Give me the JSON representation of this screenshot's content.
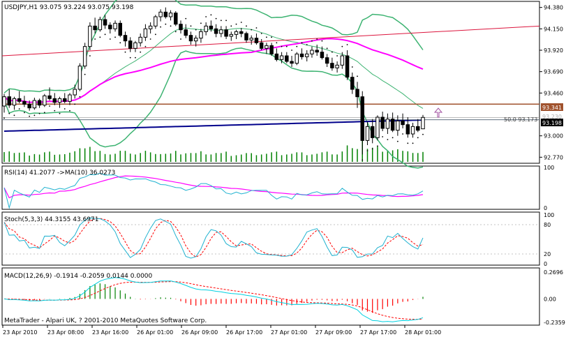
{
  "colors": {
    "background": "#ffffff",
    "frame": "#000000",
    "grid": "#c8c8c8",
    "candle": "#000000",
    "volume": "#008000",
    "bands": "#3cb371",
    "ma_blue": "#00008b",
    "ma_magenta": "#ff00ff",
    "trend_red": "#dc143c",
    "hline_brown": "#a0522d",
    "hline_gray": "#607080",
    "sar": "#000000",
    "rsi": "#20b2d0",
    "rsi_ma": "#ff00ff",
    "stoch_main": "#20b2d0",
    "stoch_signal": "#ff0000",
    "macd_main": "#00d0e0",
    "macd_signal": "#ff0000",
    "macd_osma_pos": "#008000",
    "macd_osma_neg": "#ff0000",
    "bid_label_bg": "#000000",
    "brown_label_bg": "#a0522d",
    "arrow": "#a050a0"
  },
  "main": {
    "label": "USDJPY,H1  93.075 93.224 93.075 93.198",
    "price_ticks": [
      "94.380",
      "94.150",
      "93.920",
      "93.690",
      "93.460",
      "93.000",
      "92.770"
    ],
    "price_range": [
      92.72,
      94.43
    ],
    "last_price": "93.198",
    "last_price_value": 93.198,
    "level_brown": "93.341",
    "level_brown_value": 93.341,
    "hidden_tick": "93.230",
    "fib_label": "50.0  93.173",
    "fib_level": 93.173
  },
  "rsi": {
    "label": "RSI(14) 41.2077  ->MA(10) 36.0273",
    "ticks": [
      "100",
      "0"
    ],
    "range": [
      0,
      100
    ]
  },
  "stoch": {
    "label": "Stoch(5,3,3) 44.3155 43.6971",
    "ticks": [
      "100",
      "80",
      "20",
      "0"
    ],
    "range": [
      0,
      100
    ],
    "levels": [
      80,
      20
    ]
  },
  "macd": {
    "label": "MACD(12,26,9) -0.1914 -0.2059 0.0144 0.0000",
    "ticks": [
      "0.2696",
      "0.00",
      "-0.2359"
    ],
    "range": [
      -0.2359,
      0.2696
    ]
  },
  "copyright": "MetaTrader - Alpari UK, ? 2001-2010 MetaQuotes Software Corp.",
  "time_labels": [
    "23 Apr 2010",
    "23 Apr 08:00",
    "23 Apr 16:00",
    "26 Apr 01:00",
    "26 Apr 09:00",
    "26 Apr 17:00",
    "27 Apr 01:00",
    "27 Apr 09:00",
    "27 Apr 17:00",
    "28 Apr 01:00"
  ],
  "chart_data": {
    "type": "candlestick",
    "symbol": "USDJPY",
    "timeframe": "H1",
    "candles_ohlc": [
      [
        93.32,
        93.45,
        93.25,
        93.42
      ],
      [
        93.42,
        93.5,
        93.3,
        93.33
      ],
      [
        93.33,
        93.42,
        93.28,
        93.4
      ],
      [
        93.4,
        93.48,
        93.35,
        93.37
      ],
      [
        93.37,
        93.43,
        93.31,
        93.34
      ],
      [
        93.34,
        93.38,
        93.27,
        93.3
      ],
      [
        93.3,
        93.41,
        93.28,
        93.38
      ],
      [
        93.38,
        93.4,
        93.3,
        93.33
      ],
      [
        93.33,
        93.45,
        93.31,
        93.43
      ],
      [
        93.43,
        93.52,
        93.38,
        93.4
      ],
      [
        93.4,
        93.46,
        93.33,
        93.36
      ],
      [
        93.36,
        93.42,
        93.3,
        93.4
      ],
      [
        93.4,
        93.46,
        93.35,
        93.37
      ],
      [
        93.37,
        93.46,
        93.33,
        93.44
      ],
      [
        93.44,
        93.55,
        93.4,
        93.5
      ],
      [
        93.5,
        93.78,
        93.48,
        93.75
      ],
      [
        93.75,
        94.0,
        93.72,
        93.96
      ],
      [
        93.96,
        94.22,
        93.92,
        94.18
      ],
      [
        94.18,
        94.27,
        94.1,
        94.14
      ],
      [
        94.14,
        94.28,
        94.12,
        94.25
      ],
      [
        94.25,
        94.3,
        94.15,
        94.19
      ],
      [
        94.19,
        94.22,
        94.1,
        94.15
      ],
      [
        94.15,
        94.24,
        94.12,
        94.21
      ],
      [
        94.21,
        94.24,
        94.06,
        94.08
      ],
      [
        94.08,
        94.12,
        93.96,
        94.02
      ],
      [
        94.02,
        94.06,
        93.9,
        93.94
      ],
      [
        93.94,
        94.02,
        93.9,
        94.0
      ],
      [
        94.0,
        94.1,
        93.96,
        94.06
      ],
      [
        94.06,
        94.2,
        94.02,
        94.15
      ],
      [
        94.15,
        94.22,
        94.1,
        94.18
      ],
      [
        94.18,
        94.3,
        94.15,
        94.28
      ],
      [
        94.28,
        94.36,
        94.23,
        94.33
      ],
      [
        94.33,
        94.38,
        94.26,
        94.28
      ],
      [
        94.28,
        94.35,
        94.24,
        94.32
      ],
      [
        94.32,
        94.34,
        94.18,
        94.2
      ],
      [
        94.2,
        94.24,
        94.1,
        94.14
      ],
      [
        94.14,
        94.2,
        94.05,
        94.08
      ],
      [
        94.08,
        94.12,
        93.98,
        94.02
      ],
      [
        94.02,
        94.08,
        93.96,
        94.05
      ],
      [
        94.05,
        94.15,
        94.0,
        94.12
      ],
      [
        94.12,
        94.22,
        94.08,
        94.18
      ],
      [
        94.18,
        94.24,
        94.12,
        94.15
      ],
      [
        94.15,
        94.2,
        94.06,
        94.1
      ],
      [
        94.1,
        94.18,
        94.06,
        94.14
      ],
      [
        94.14,
        94.18,
        94.04,
        94.07
      ],
      [
        94.07,
        94.12,
        94.02,
        94.09
      ],
      [
        94.09,
        94.14,
        94.04,
        94.12
      ],
      [
        94.12,
        94.16,
        94.06,
        94.1
      ],
      [
        94.1,
        94.12,
        94.0,
        94.03
      ],
      [
        94.03,
        94.08,
        93.98,
        94.05
      ],
      [
        94.05,
        94.1,
        93.98,
        94.0
      ],
      [
        94.0,
        94.04,
        93.92,
        93.94
      ],
      [
        93.94,
        94.0,
        93.88,
        93.97
      ],
      [
        93.97,
        94.0,
        93.86,
        93.88
      ],
      [
        93.88,
        93.94,
        93.8,
        93.82
      ],
      [
        93.82,
        93.9,
        93.78,
        93.86
      ],
      [
        93.86,
        93.9,
        93.78,
        93.8
      ],
      [
        93.8,
        93.86,
        93.74,
        93.78
      ],
      [
        93.78,
        93.9,
        93.76,
        93.88
      ],
      [
        93.88,
        93.94,
        93.82,
        93.85
      ],
      [
        93.85,
        93.92,
        93.8,
        93.88
      ],
      [
        93.88,
        93.96,
        93.84,
        93.92
      ],
      [
        93.92,
        93.98,
        93.86,
        93.9
      ],
      [
        93.9,
        93.96,
        93.82,
        93.84
      ],
      [
        93.84,
        93.88,
        93.74,
        93.78
      ],
      [
        93.78,
        93.84,
        93.7,
        93.73
      ],
      [
        93.73,
        93.8,
        93.68,
        93.76
      ],
      [
        93.76,
        93.9,
        93.72,
        93.86
      ],
      [
        93.86,
        93.92,
        93.6,
        93.63
      ],
      [
        93.63,
        93.68,
        93.45,
        93.5
      ],
      [
        93.5,
        93.58,
        93.3,
        93.42
      ],
      [
        93.42,
        93.48,
        92.8,
        92.95
      ],
      [
        92.95,
        93.15,
        92.9,
        93.1
      ],
      [
        93.1,
        93.18,
        92.92,
        92.98
      ],
      [
        92.98,
        93.22,
        92.95,
        93.2
      ],
      [
        93.2,
        93.26,
        93.05,
        93.08
      ],
      [
        93.08,
        93.24,
        93.02,
        93.18
      ],
      [
        93.18,
        93.25,
        93.04,
        93.06
      ],
      [
        93.06,
        93.22,
        93.0,
        93.16
      ],
      [
        93.16,
        93.24,
        93.08,
        93.12
      ],
      [
        93.12,
        93.2,
        92.98,
        93.02
      ],
      [
        93.02,
        93.14,
        92.98,
        93.1
      ],
      [
        93.1,
        93.18,
        93.04,
        93.06
      ],
      [
        93.075,
        93.224,
        93.075,
        93.198
      ]
    ]
  }
}
